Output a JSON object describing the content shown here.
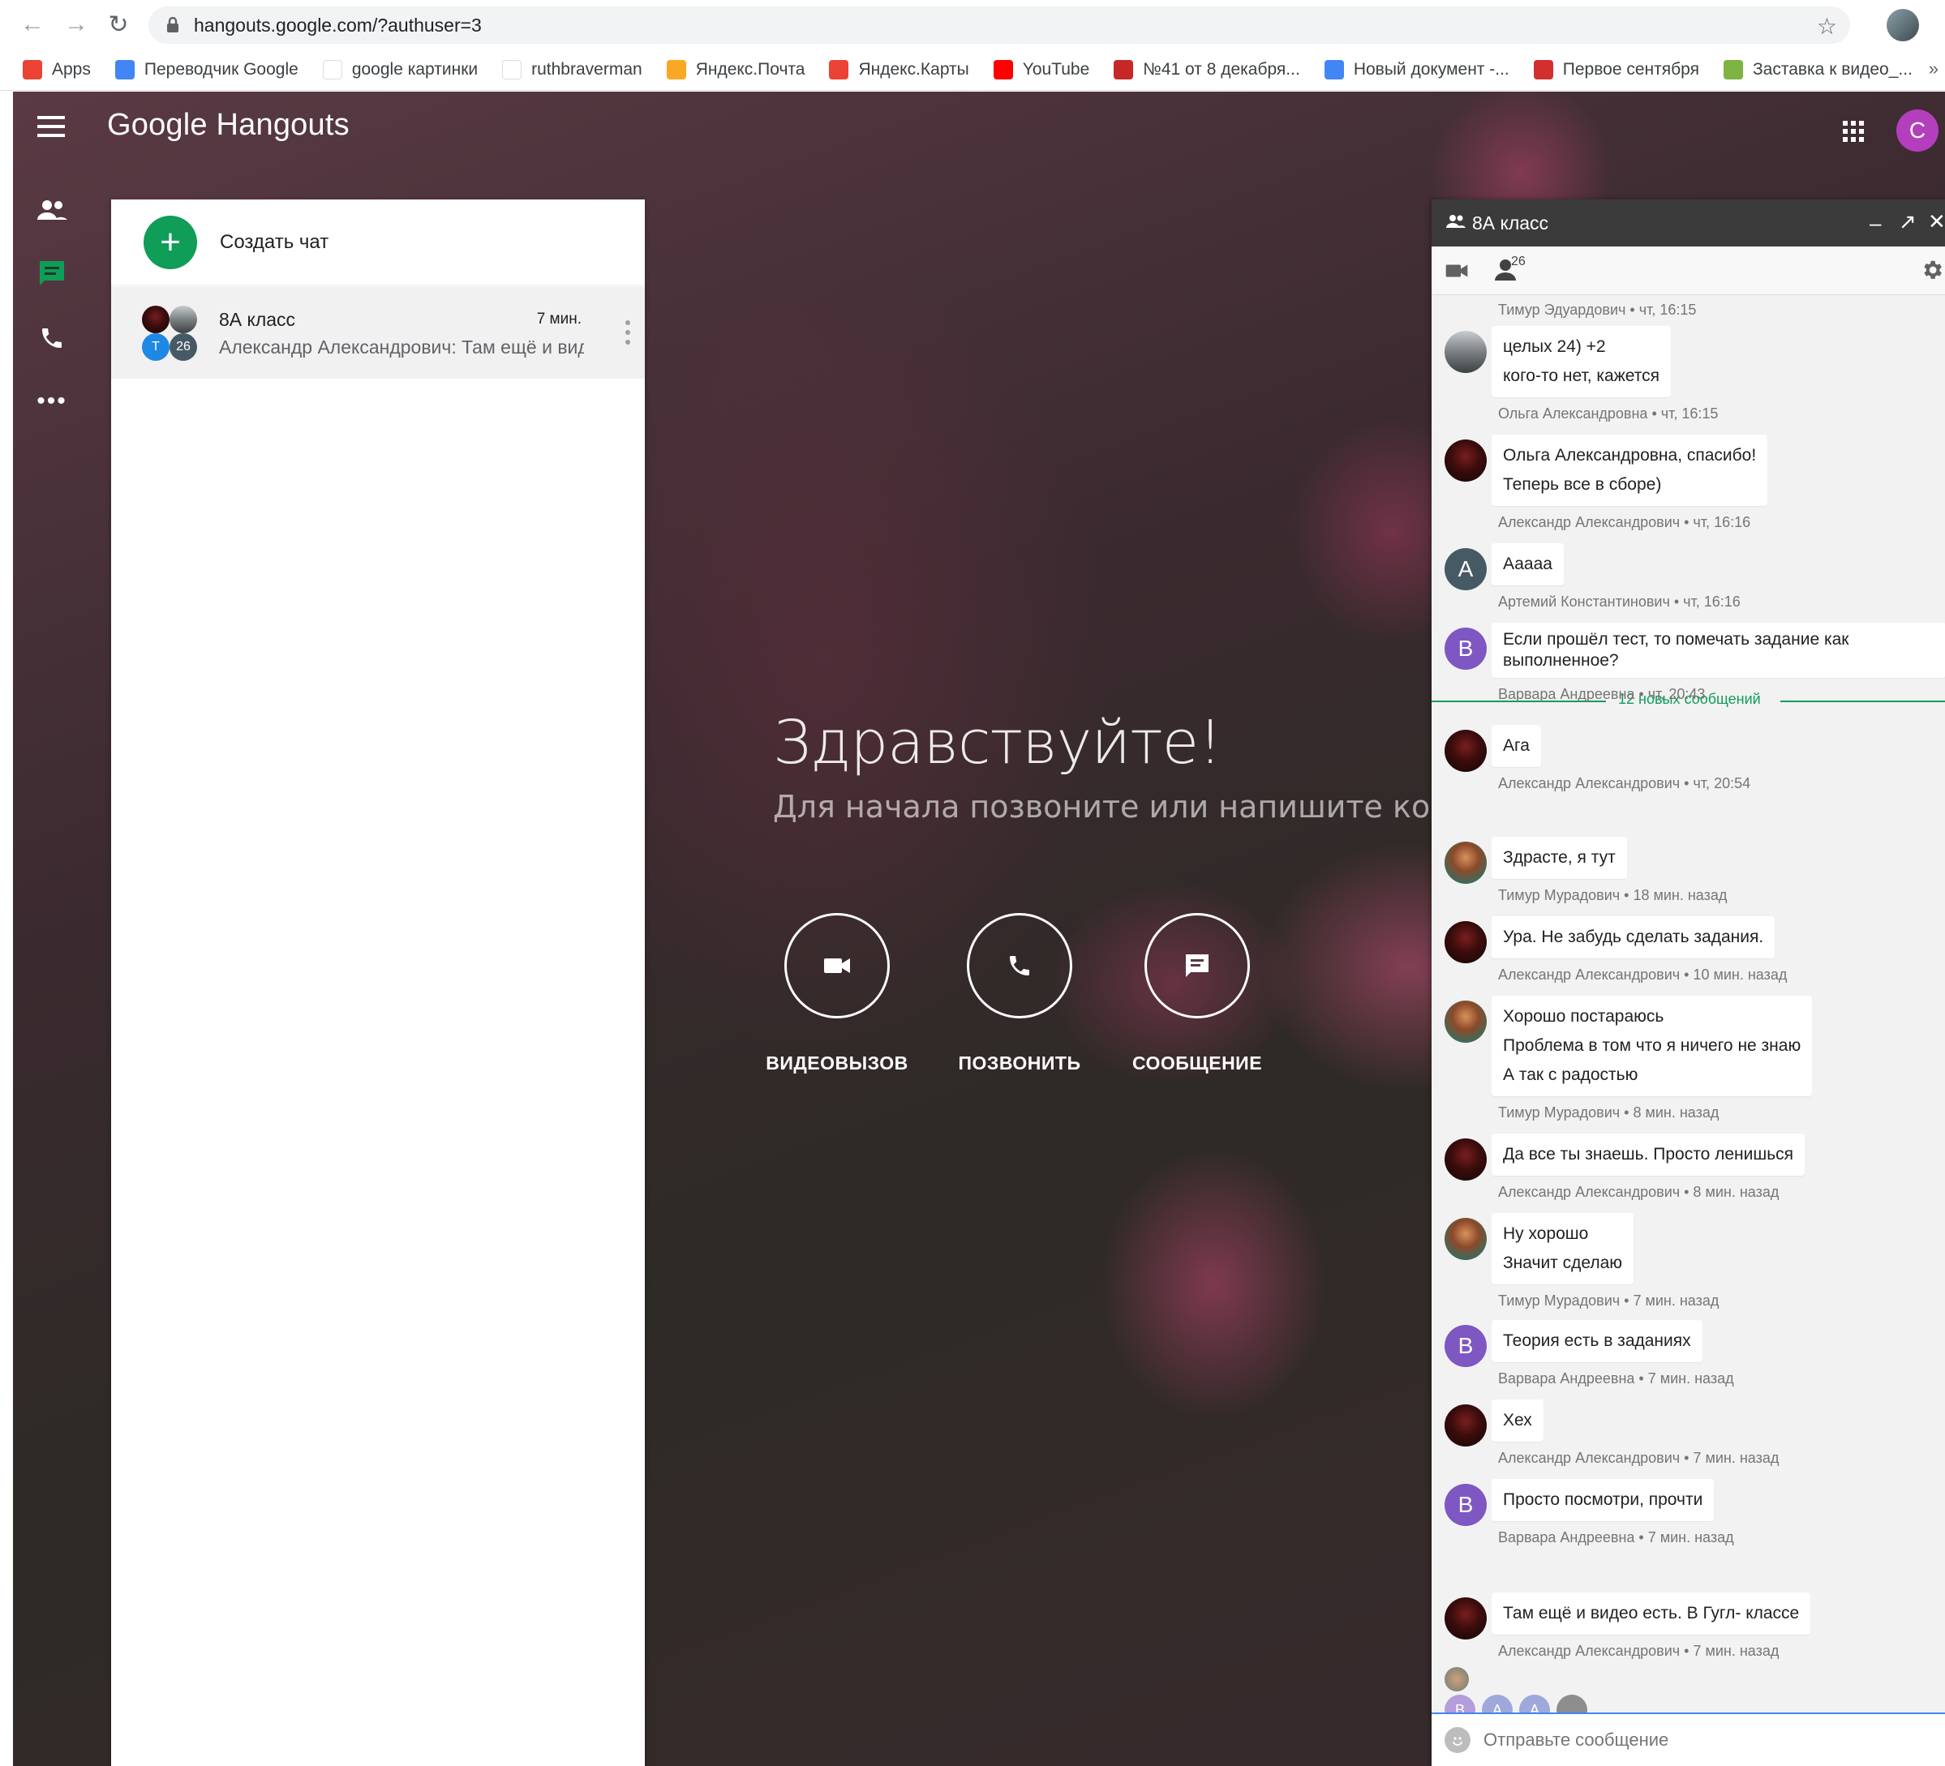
{
  "browser": {
    "url": "hangouts.google.com/?authuser=3",
    "bookmarks": [
      {
        "label": "Apps",
        "icon": "apps-grid-icon",
        "color": "#ea4335"
      },
      {
        "label": "Переводчик Google",
        "icon": "translate-icon",
        "color": "#4285f4"
      },
      {
        "label": "google картинки",
        "icon": "google-g-icon",
        "color": "#ffffff"
      },
      {
        "label": "ruthbraverman",
        "icon": "gmail-icon",
        "color": "#ffffff"
      },
      {
        "label": "Яндекс.Почта",
        "icon": "mail-icon",
        "color": "#f9a825"
      },
      {
        "label": "Яндекс.Карты",
        "icon": "map-pin-icon",
        "color": "#ea4335"
      },
      {
        "label": "YouTube",
        "icon": "youtube-icon",
        "color": "#ff0000"
      },
      {
        "label": "№41 от 8 декабря...",
        "icon": "bookmark-icon",
        "color": "#c62828"
      },
      {
        "label": "Новый документ -...",
        "icon": "docs-icon",
        "color": "#4285f4"
      },
      {
        "label": "Первое сентября",
        "icon": "bookmark-icon",
        "color": "#d32f2f"
      },
      {
        "label": "Заставка к видео_...",
        "icon": "leaf-icon",
        "color": "#7cb342"
      }
    ]
  },
  "app": {
    "title_google": "Google",
    "title_product": "Hangouts",
    "user_initial": "C",
    "user_color": "#b43fbd"
  },
  "conversations": {
    "create_label": "Создать чат",
    "items": [
      {
        "name": "8А класс",
        "time": "7 мин.",
        "preview": "Александр Александрович: Там ещё и видео есть. В Гугл- классе",
        "badge_initial": "T",
        "badge_count": "26"
      }
    ]
  },
  "main": {
    "greeting": "Здравствуйте!",
    "subgreeting": "Для начала позвоните или напишите кому-нибудь",
    "actions": [
      {
        "label": "ВИДЕОВЫЗОВ",
        "icon": "videocam-icon"
      },
      {
        "label": "ПОЗВОНИТЬ",
        "icon": "phone-icon"
      },
      {
        "label": "СООБЩЕНИЕ",
        "icon": "message-icon"
      }
    ]
  },
  "chat": {
    "title": "8А класс",
    "participants": "26",
    "first_ts": "Тимур Эдуардович • чт, 16:15",
    "new_divider": "12 новых сообщений",
    "messages": [
      {
        "lines": [
          "целых 24) +2",
          "кого-то нет, кажется"
        ],
        "meta": "Ольга Александровна • чт, 16:15",
        "avatar": "photo-o",
        "initial": ""
      },
      {
        "lines": [
          "Ольга Александровна, спасибо!",
          "Теперь все в сборе)"
        ],
        "meta": "Александр Александрович • чт, 16:16",
        "avatar": "photo-a",
        "initial": ""
      },
      {
        "lines": [
          "Ааааа"
        ],
        "meta": "Артемий Константинович • чт, 16:16",
        "avatar": "letter",
        "initial": "A",
        "color": "#455a64"
      },
      {
        "lines": [
          "Если прошёл тест, то помечать задание как",
          "выполненное?"
        ],
        "meta": "Варвара Андреевна • чт, 20:43",
        "avatar": "letter",
        "initial": "B",
        "color": "#7e57c2"
      },
      {
        "lines": [
          "Ага"
        ],
        "meta": "Александр Александрович • чт, 20:54",
        "avatar": "photo-a",
        "initial": ""
      },
      {
        "lines": [
          "Здрасте, я тут"
        ],
        "meta": "Тимур Мурадович • 18 мин. назад",
        "avatar": "photo-t",
        "initial": ""
      },
      {
        "lines": [
          "Ура. Не забудь сделать задания."
        ],
        "meta": "Александр Александрович • 10 мин. назад",
        "avatar": "photo-a",
        "initial": ""
      },
      {
        "lines": [
          "Хорошо постараюсь",
          "Проблема в том что я ничего не знаю",
          "А так с радостью"
        ],
        "meta": "Тимур Мурадович • 8 мин. назад",
        "avatar": "photo-t",
        "initial": ""
      },
      {
        "lines": [
          "Да все ты знаешь. Просто ленишься"
        ],
        "meta": "Александр Александрович • 8 мин. назад",
        "avatar": "photo-a",
        "initial": ""
      },
      {
        "lines": [
          "Ну хорошо",
          "Значит сделаю"
        ],
        "meta": "Тимур Мурадович • 7 мин. назад",
        "avatar": "photo-t",
        "initial": ""
      },
      {
        "lines": [
          "Теория есть в заданиях"
        ],
        "meta": "Варвара Андреевна • 7 мин. назад",
        "avatar": "letter",
        "initial": "B",
        "color": "#7e57c2"
      },
      {
        "lines": [
          "Хех"
        ],
        "meta": "Александр Александрович • 7 мин. назад",
        "avatar": "photo-a",
        "initial": ""
      },
      {
        "lines": [
          "Просто посмотри, прочти"
        ],
        "meta": "Варвара Андреевна • 7 мин. назад",
        "avatar": "letter",
        "initial": "B",
        "color": "#7e57c2"
      },
      {
        "lines": [
          "Там ещё и видео есть. В Гугл- классе"
        ],
        "meta": "Александр Александрович • 7 мин. назад",
        "avatar": "photo-a",
        "initial": ""
      }
    ],
    "readers": [
      {
        "initial": "B",
        "color": "#b39ddb"
      },
      {
        "initial": "A",
        "color": "#9fa8da"
      },
      {
        "initial": "A",
        "color": "#9fa8da"
      },
      {
        "initial": "",
        "color": "#8d8d8d"
      }
    ],
    "compose_placeholder": "Отправьте сообщение"
  },
  "colors": {
    "accent_green": "#0f9d58",
    "chat_header": "#3b3b3b",
    "link_blue": "#4285f4"
  }
}
